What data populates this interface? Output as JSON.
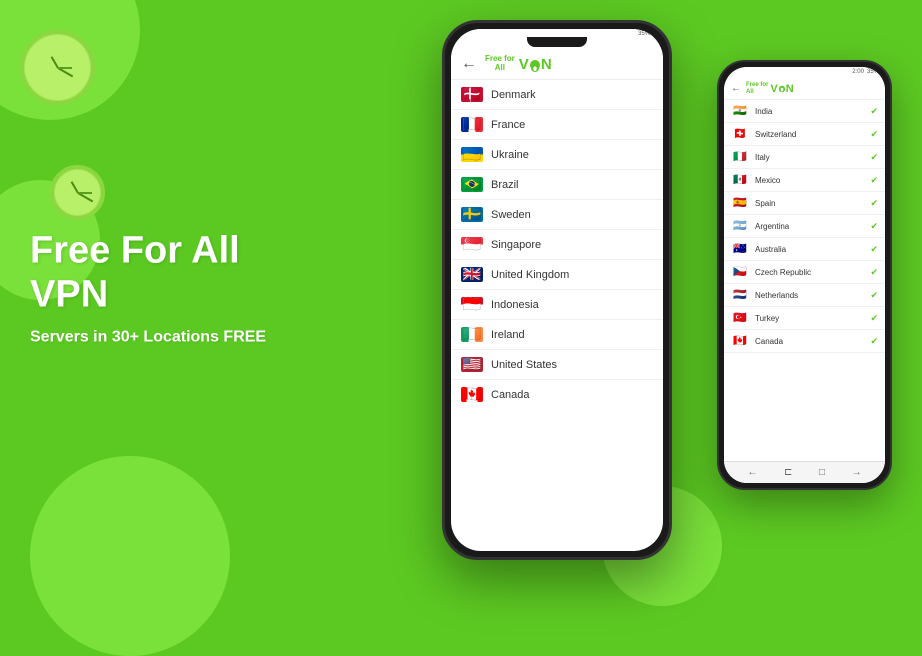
{
  "background": {
    "color": "#5cc922"
  },
  "left_panel": {
    "title_line1": "Free For All",
    "title_line2": "VPN",
    "subtitle": "Servers in 30+ Locations FREE"
  },
  "app": {
    "name": "Free for All VPN",
    "back_label": "←",
    "logo_text": "Free for All",
    "logo_vpn": "VPN"
  },
  "main_phone": {
    "countries": [
      {
        "name": "Denmark",
        "flag_class": "flag-denmark",
        "flag_emoji": "🇩🇰"
      },
      {
        "name": "France",
        "flag_class": "flag-france",
        "flag_emoji": "🇫🇷"
      },
      {
        "name": "Ukraine",
        "flag_class": "flag-ukraine",
        "flag_emoji": "🇺🇦"
      },
      {
        "name": "Brazil",
        "flag_class": "flag-brazil",
        "flag_emoji": "🇧🇷"
      },
      {
        "name": "Sweden",
        "flag_class": "flag-sweden",
        "flag_emoji": "🇸🇪"
      },
      {
        "name": "Singapore",
        "flag_class": "flag-singapore",
        "flag_emoji": "🇸🇬"
      },
      {
        "name": "United Kingdom",
        "flag_class": "flag-uk",
        "flag_emoji": "🇬🇧"
      },
      {
        "name": "Indonesia",
        "flag_class": "flag-indonesia",
        "flag_emoji": "🇮🇩"
      },
      {
        "name": "Ireland",
        "flag_class": "flag-ireland",
        "flag_emoji": "🇮🇪"
      },
      {
        "name": "United States",
        "flag_class": "flag-us",
        "flag_emoji": "🇺🇸"
      },
      {
        "name": "Canada",
        "flag_class": "flag-canada",
        "flag_emoji": "🇨🇦"
      }
    ]
  },
  "small_phone": {
    "status": "2:00",
    "battery": "35%",
    "countries": [
      {
        "name": "India",
        "flag_class": "flag-india",
        "flag_emoji": "🇮🇳",
        "checked": true
      },
      {
        "name": "Switzerland",
        "flag_class": "flag-switzerland",
        "flag_emoji": "🇨🇭",
        "checked": true
      },
      {
        "name": "Italy",
        "flag_class": "flag-italy",
        "flag_emoji": "🇮🇹",
        "checked": true
      },
      {
        "name": "Mexico",
        "flag_class": "flag-mexico",
        "flag_emoji": "🇲🇽",
        "checked": true
      },
      {
        "name": "Spain",
        "flag_class": "flag-spain",
        "flag_emoji": "🇪🇸",
        "checked": true
      },
      {
        "name": "Argentina",
        "flag_class": "flag-argentina",
        "flag_emoji": "🇦🇷",
        "checked": true
      },
      {
        "name": "Australia",
        "flag_class": "flag-australia",
        "flag_emoji": "🇦🇺",
        "checked": true
      },
      {
        "name": "Czech Republic",
        "flag_class": "flag-czech",
        "flag_emoji": "🇨🇿",
        "checked": true
      },
      {
        "name": "Netherlands",
        "flag_class": "flag-netherlands",
        "flag_emoji": "🇳🇱",
        "checked": true
      },
      {
        "name": "Turkey",
        "flag_class": "flag-turkey",
        "flag_emoji": "🇹🇷",
        "checked": true
      },
      {
        "name": "Canada",
        "flag_class": "flag-canada",
        "flag_emoji": "🇨🇦",
        "checked": true
      }
    ]
  }
}
